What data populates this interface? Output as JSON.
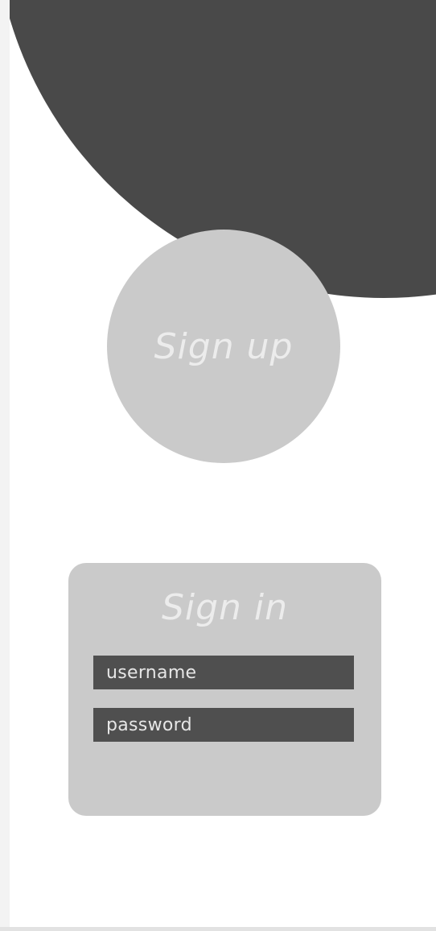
{
  "signup": {
    "label": "Sign up"
  },
  "signin": {
    "title": "Sign in",
    "username_placeholder": "username",
    "password_placeholder": "password"
  },
  "colors": {
    "header_shape": "#494949",
    "circle_and_card": "#cacaca",
    "field_background": "#4f4f4f",
    "light_text": "#ececec"
  }
}
